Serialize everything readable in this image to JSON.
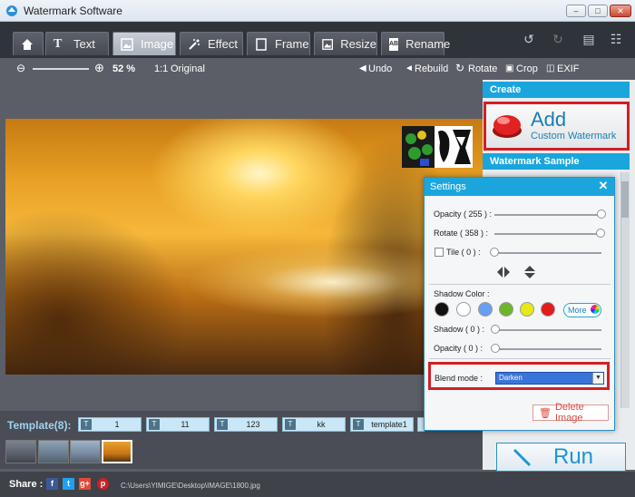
{
  "window": {
    "title": "Watermark Software"
  },
  "tabs": [
    {
      "label": "",
      "icon": "home-icon"
    },
    {
      "label": "Text",
      "icon": "text-icon"
    },
    {
      "label": "Image",
      "icon": "image-icon"
    },
    {
      "label": "Effect",
      "icon": "effect-wand-icon"
    },
    {
      "label": "Frame",
      "icon": "frame-icon"
    },
    {
      "label": "Resize",
      "icon": "resize-icon"
    },
    {
      "label": "Rename",
      "icon": "rename-ab-icon"
    }
  ],
  "toolbar": {
    "zoom_value": "52 %",
    "original_label": "Original",
    "undo_label": "Undo",
    "rebuild_label": "Rebuild",
    "rotate_label": "Rotate",
    "crop_label": "Crop",
    "exif_label": "EXIF"
  },
  "right_panel": {
    "create_header": "Create",
    "add_title": "Add",
    "add_subtitle": "Custom Watermark",
    "sample_header": "Watermark Sample"
  },
  "settings": {
    "title": "Settings",
    "opacity_label": "Opacity ( 255 ) :",
    "rotate_label": "Rotate ( 358 ) :",
    "tile_label": "Tile ( 0 ) :",
    "shadow_color_label": "Shadow Color :",
    "shadow_label": "Shadow ( 0 ) :",
    "shadow_opacity_label": "Opacity ( 0 ) :",
    "more_label": "More",
    "blend_label": "Blend mode :",
    "blend_value": "Darken",
    "delete_label": "Delete Image",
    "swatches": [
      "#111111",
      "#ffffff",
      "#6a9ef0",
      "#6fb52a",
      "#e8e81a",
      "#e31b1b"
    ],
    "opacity_level": 1.0,
    "rotate_level": 0.994,
    "tile_level": 0.0
  },
  "templates": {
    "label": "Template(8):",
    "items": [
      "1",
      "11",
      "123",
      "kk",
      "template1"
    ]
  },
  "run_label": "Run",
  "status": {
    "share_label": "Share :",
    "path": "C:\\Users\\YIMIGE\\Desktop\\IMAGE\\1800.jpg"
  }
}
